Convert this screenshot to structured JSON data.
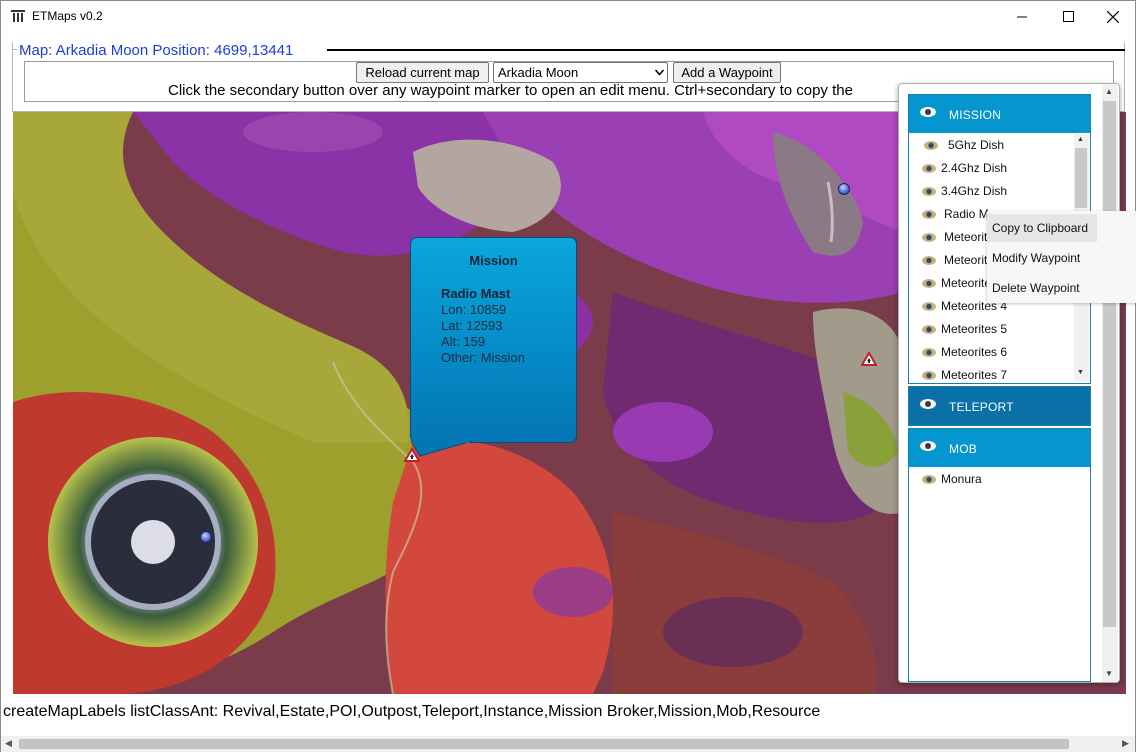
{
  "window": {
    "title": "ETMaps v0.2",
    "controls": {
      "minimize": "—",
      "maximize": "☐",
      "close": "✕"
    }
  },
  "header": {
    "legend": "Map: Arkadia Moon  Position: 4699,13441",
    "reload_label": "Reload current map",
    "map_select_value": "Arkadia Moon",
    "add_waypoint_label": "Add a Waypoint",
    "hint": "Click the secondary button over any waypoint marker to open an edit menu. Ctrl+secondary to copy the"
  },
  "popup": {
    "title": "Mission",
    "name": "Radio Mast",
    "lon": "Lon: 10859",
    "lat": "Lat: 12593",
    "alt": "Alt: 159",
    "other": "Other: Mission"
  },
  "panel": {
    "groups": [
      {
        "label": "MISSION"
      },
      {
        "label": "TELEPORT"
      },
      {
        "label": "MOB"
      }
    ],
    "mission_items": [
      "5Ghz Dish",
      "2.4Ghz Dish",
      "3.4Ghz Dish",
      "Radio M",
      "Meteorit",
      "Meteorit",
      "Meteorite",
      "Meteorites 4",
      "Meteorites 5",
      "Meteorites 6",
      "Meteorites 7"
    ],
    "mob_items": [
      "Monura"
    ]
  },
  "context_menu": {
    "copy": "Copy to Clipboard",
    "modify": "Modify Waypoint",
    "delete": "Delete Waypoint"
  },
  "status_text": "createMapLabels listClassAnt: Revival,Estate,POI,Outpost,Teleport,Instance,Mission Broker,Mission,Mob,Resource",
  "colors": {
    "legend_text": "#1c3ed8",
    "group_header": "#0596d0",
    "group_header_selected": "#0a70a8",
    "popup_top": "#0aa6dc",
    "popup_bottom": "#0376b4"
  },
  "icons": {
    "app": "filter-icon",
    "visibility": "eye-icon",
    "waypoint_mission": "warning-triangle-icon",
    "waypoint_other": "blue-dot-icon"
  }
}
